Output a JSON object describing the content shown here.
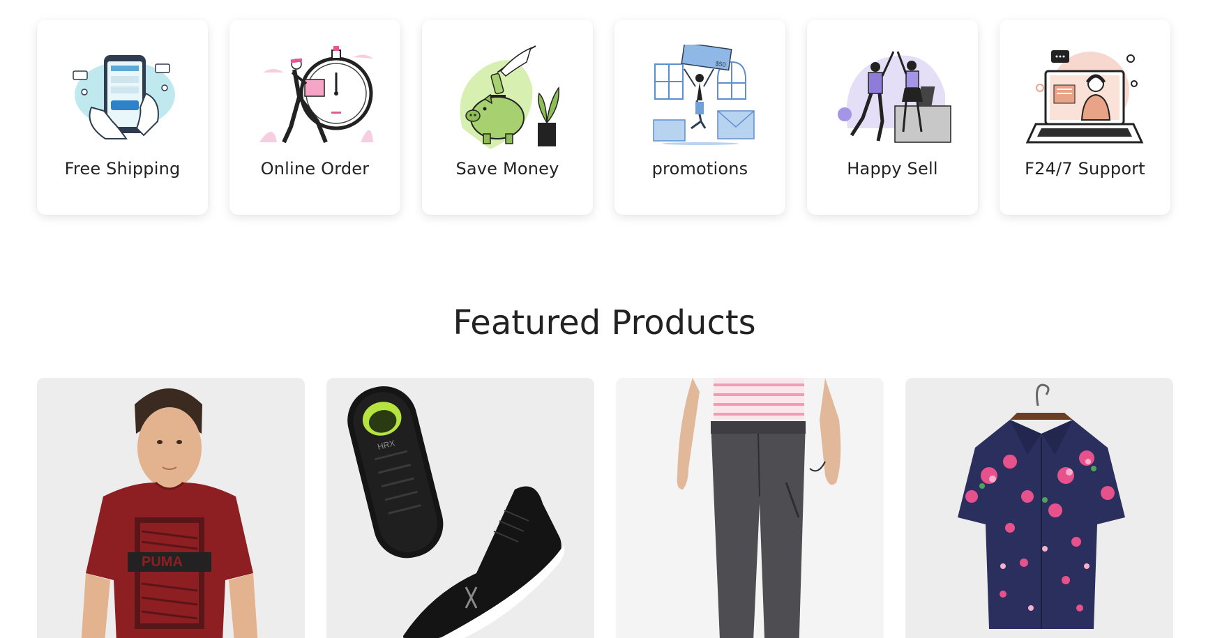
{
  "features": [
    {
      "label": "Free Shipping",
      "icon": "phone-payment-illustration"
    },
    {
      "label": "Online Order",
      "icon": "stopwatch-courier-illustration"
    },
    {
      "label": "Save Money",
      "icon": "piggy-bank-illustration"
    },
    {
      "label": "promotions",
      "icon": "gift-voucher-illustration"
    },
    {
      "label": "Happy Sell",
      "icon": "high-five-illustration"
    },
    {
      "label": "F24/7 Support",
      "icon": "laptop-support-illustration"
    }
  ],
  "featured": {
    "title": "Featured Products",
    "products": [
      {
        "name": "red-printed-tshirt",
        "image": "man-in-red-tshirt"
      },
      {
        "name": "black-sneakers",
        "image": "black-running-shoes",
        "brand_mark": "HRX"
      },
      {
        "name": "grey-joggers",
        "image": "grey-track-pants"
      },
      {
        "name": "floral-shirt",
        "image": "navy-floral-shirt"
      }
    ]
  }
}
